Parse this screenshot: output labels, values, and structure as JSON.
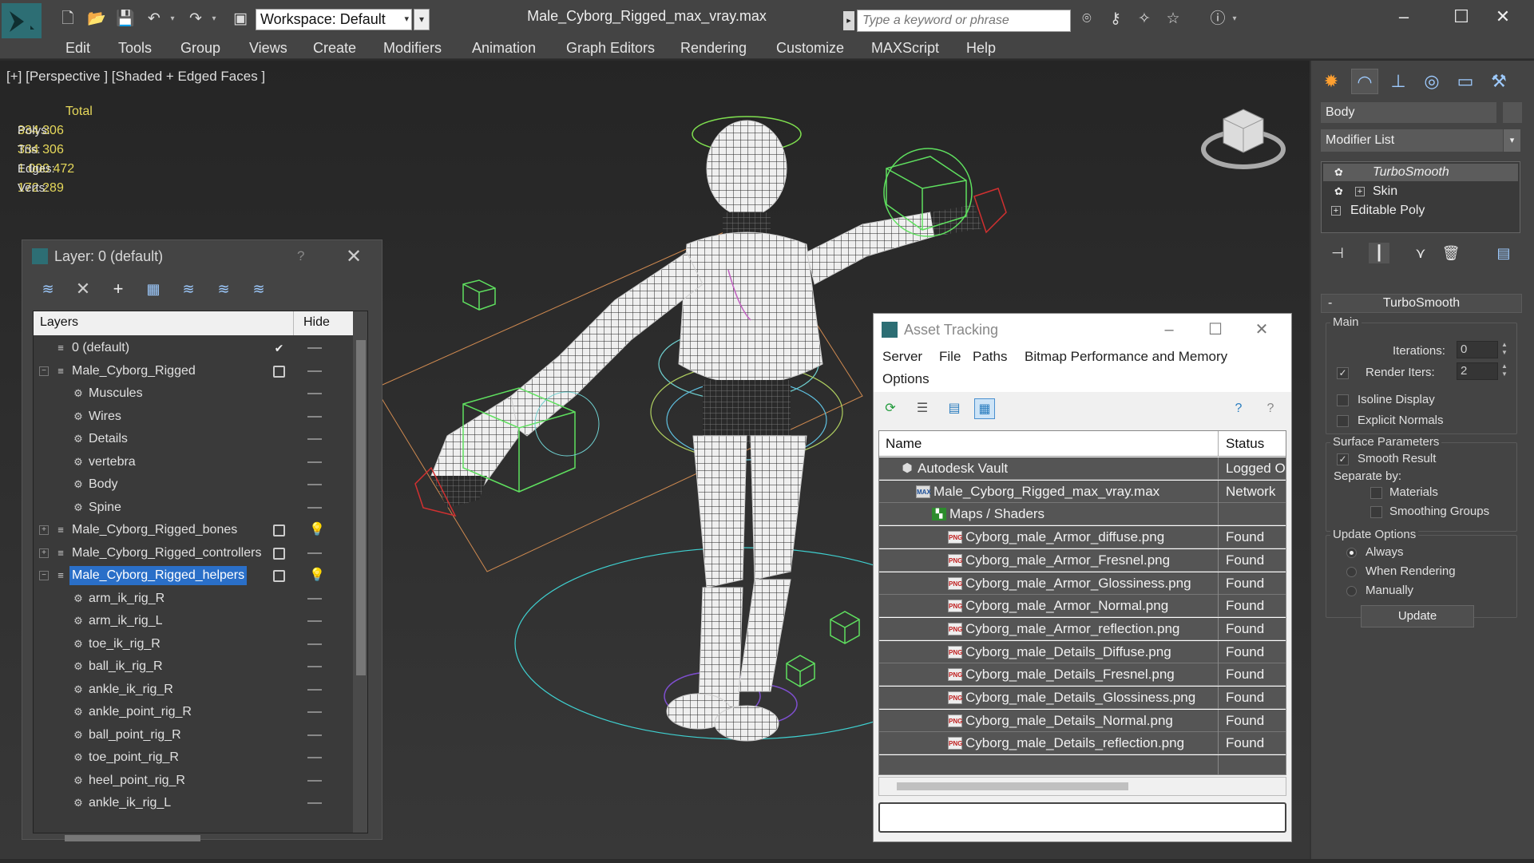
{
  "titlebar": {
    "workspace": "Workspace: Default",
    "document": "Male_Cyborg_Rigged_max_vray.max",
    "search_placeholder": "Type a keyword or phrase"
  },
  "menubar": [
    "Edit",
    "Tools",
    "Group",
    "Views",
    "Create",
    "Modifiers",
    "Animation",
    "Graph Editors",
    "Rendering",
    "Customize",
    "MAXScript",
    "Help"
  ],
  "viewport": {
    "label": "[+] [Perspective ] [Shaded + Edged Faces ]",
    "stats": {
      "total": "Total",
      "rows": [
        {
          "label": "Polys:",
          "value": "334 306"
        },
        {
          "label": "Tris:",
          "value": "334 306"
        },
        {
          "label": "Edges:",
          "value": "1 000 472"
        },
        {
          "label": "Verts:",
          "value": "172 289"
        }
      ]
    }
  },
  "layer_panel": {
    "title": "Layer: 0 (default)",
    "help": "?",
    "col_layers": "Layers",
    "col_hide": "Hide",
    "rows": [
      {
        "name": "0 (default)",
        "level": 0,
        "current": "check",
        "hide": "dash"
      },
      {
        "name": "Male_Cyborg_Rigged",
        "level": 0,
        "expander": "−",
        "current": "box",
        "hide": "dash"
      },
      {
        "name": "Muscules",
        "level": 1,
        "hide": "dash"
      },
      {
        "name": "Wires",
        "level": 1,
        "hide": "dash"
      },
      {
        "name": "Details",
        "level": 1,
        "hide": "dash"
      },
      {
        "name": "vertebra",
        "level": 1,
        "hide": "dash"
      },
      {
        "name": "Body",
        "level": 1,
        "hide": "dash"
      },
      {
        "name": "Spine",
        "level": 1,
        "hide": "dash"
      },
      {
        "name": "Male_Cyborg_Rigged_bones",
        "level": 0,
        "expander": "+",
        "current": "box",
        "hide": "bulb"
      },
      {
        "name": "Male_Cyborg_Rigged_controllers",
        "level": 0,
        "expander": "+",
        "current": "box",
        "hide": "dash"
      },
      {
        "name": "Male_Cyborg_Rigged_helpers",
        "level": 0,
        "expander": "−",
        "current": "box",
        "hide": "bulb",
        "selected": true
      },
      {
        "name": "arm_ik_rig_R",
        "level": 1,
        "hide": "dash"
      },
      {
        "name": "arm_ik_rig_L",
        "level": 1,
        "hide": "dash"
      },
      {
        "name": "toe_ik_rig_R",
        "level": 1,
        "hide": "dash"
      },
      {
        "name": "ball_ik_rig_R",
        "level": 1,
        "hide": "dash"
      },
      {
        "name": "ankle_ik_rig_R",
        "level": 1,
        "hide": "dash"
      },
      {
        "name": "ankle_point_rig_R",
        "level": 1,
        "hide": "dash"
      },
      {
        "name": "ball_point_rig_R",
        "level": 1,
        "hide": "dash"
      },
      {
        "name": "toe_point_rig_R",
        "level": 1,
        "hide": "dash"
      },
      {
        "name": "heel_point_rig_R",
        "level": 1,
        "hide": "dash"
      },
      {
        "name": "ankle_ik_rig_L",
        "level": 1,
        "hide": "dash"
      }
    ]
  },
  "asset_tracking": {
    "title": "Asset Tracking",
    "menu": [
      "Server",
      "File",
      "Paths",
      "Bitmap Performance and Memory",
      "Options"
    ],
    "col_name": "Name",
    "col_status": "Status",
    "rows": [
      {
        "name": "Autodesk Vault",
        "status": "Logged O",
        "icon": "vault",
        "level": 1
      },
      {
        "name": "Male_Cyborg_Rigged_max_vray.max",
        "status": "Network",
        "icon": "max",
        "level": 2
      },
      {
        "name": "Maps / Shaders",
        "status": "",
        "icon": "maps",
        "level": 3
      },
      {
        "name": "Cyborg_male_Armor_diffuse.png",
        "status": "Found",
        "icon": "png",
        "level": 4
      },
      {
        "name": "Cyborg_male_Armor_Fresnel.png",
        "status": "Found",
        "icon": "png",
        "level": 4
      },
      {
        "name": "Cyborg_male_Armor_Glossiness.png",
        "status": "Found",
        "icon": "png",
        "level": 4
      },
      {
        "name": "Cyborg_male_Armor_Normal.png",
        "status": "Found",
        "icon": "png",
        "level": 4
      },
      {
        "name": "Cyborg_male_Armor_reflection.png",
        "status": "Found",
        "icon": "png",
        "level": 4
      },
      {
        "name": "Cyborg_male_Details_Diffuse.png",
        "status": "Found",
        "icon": "png",
        "level": 4
      },
      {
        "name": "Cyborg_male_Details_Fresnel.png",
        "status": "Found",
        "icon": "png",
        "level": 4
      },
      {
        "name": "Cyborg_male_Details_Glossiness.png",
        "status": "Found",
        "icon": "png",
        "level": 4
      },
      {
        "name": "Cyborg_male_Details_Normal.png",
        "status": "Found",
        "icon": "png",
        "level": 4
      },
      {
        "name": "Cyborg_male_Details_reflection.png",
        "status": "Found",
        "icon": "png",
        "level": 4
      },
      {
        "name": "",
        "status": "",
        "icon": "",
        "level": 0
      }
    ]
  },
  "command_panel": {
    "object_name": "Body",
    "modifier_list": "Modifier List",
    "stack": [
      {
        "name": "TurboSmooth",
        "icon": "bulb",
        "top": true
      },
      {
        "name": "Skin",
        "icon": "bulb",
        "box": "+"
      },
      {
        "name": "Editable Poly",
        "icon": "",
        "box": "+"
      }
    ],
    "turbosmooth": {
      "header": "TurboSmooth",
      "collapse": "-",
      "main": "Main",
      "iterations_label": "Iterations:",
      "iterations": "0",
      "render_iters_label": "Render Iters:",
      "render_iters": "2",
      "isoline": "Isoline Display",
      "explicit_normals": "Explicit Normals",
      "surface_params": "Surface Parameters",
      "smooth_result": "Smooth Result",
      "separate_by": "Separate by:",
      "materials": "Materials",
      "smoothing_groups": "Smoothing Groups",
      "update_options": "Update Options",
      "always": "Always",
      "when_rendering": "When Rendering",
      "manually": "Manually",
      "update": "Update"
    }
  },
  "icons": {
    "accent": "#2d6e74",
    "selection": "#2a6fc8",
    "helper_green": "#5fe05f",
    "stats_yellow": "#e6d85a"
  }
}
